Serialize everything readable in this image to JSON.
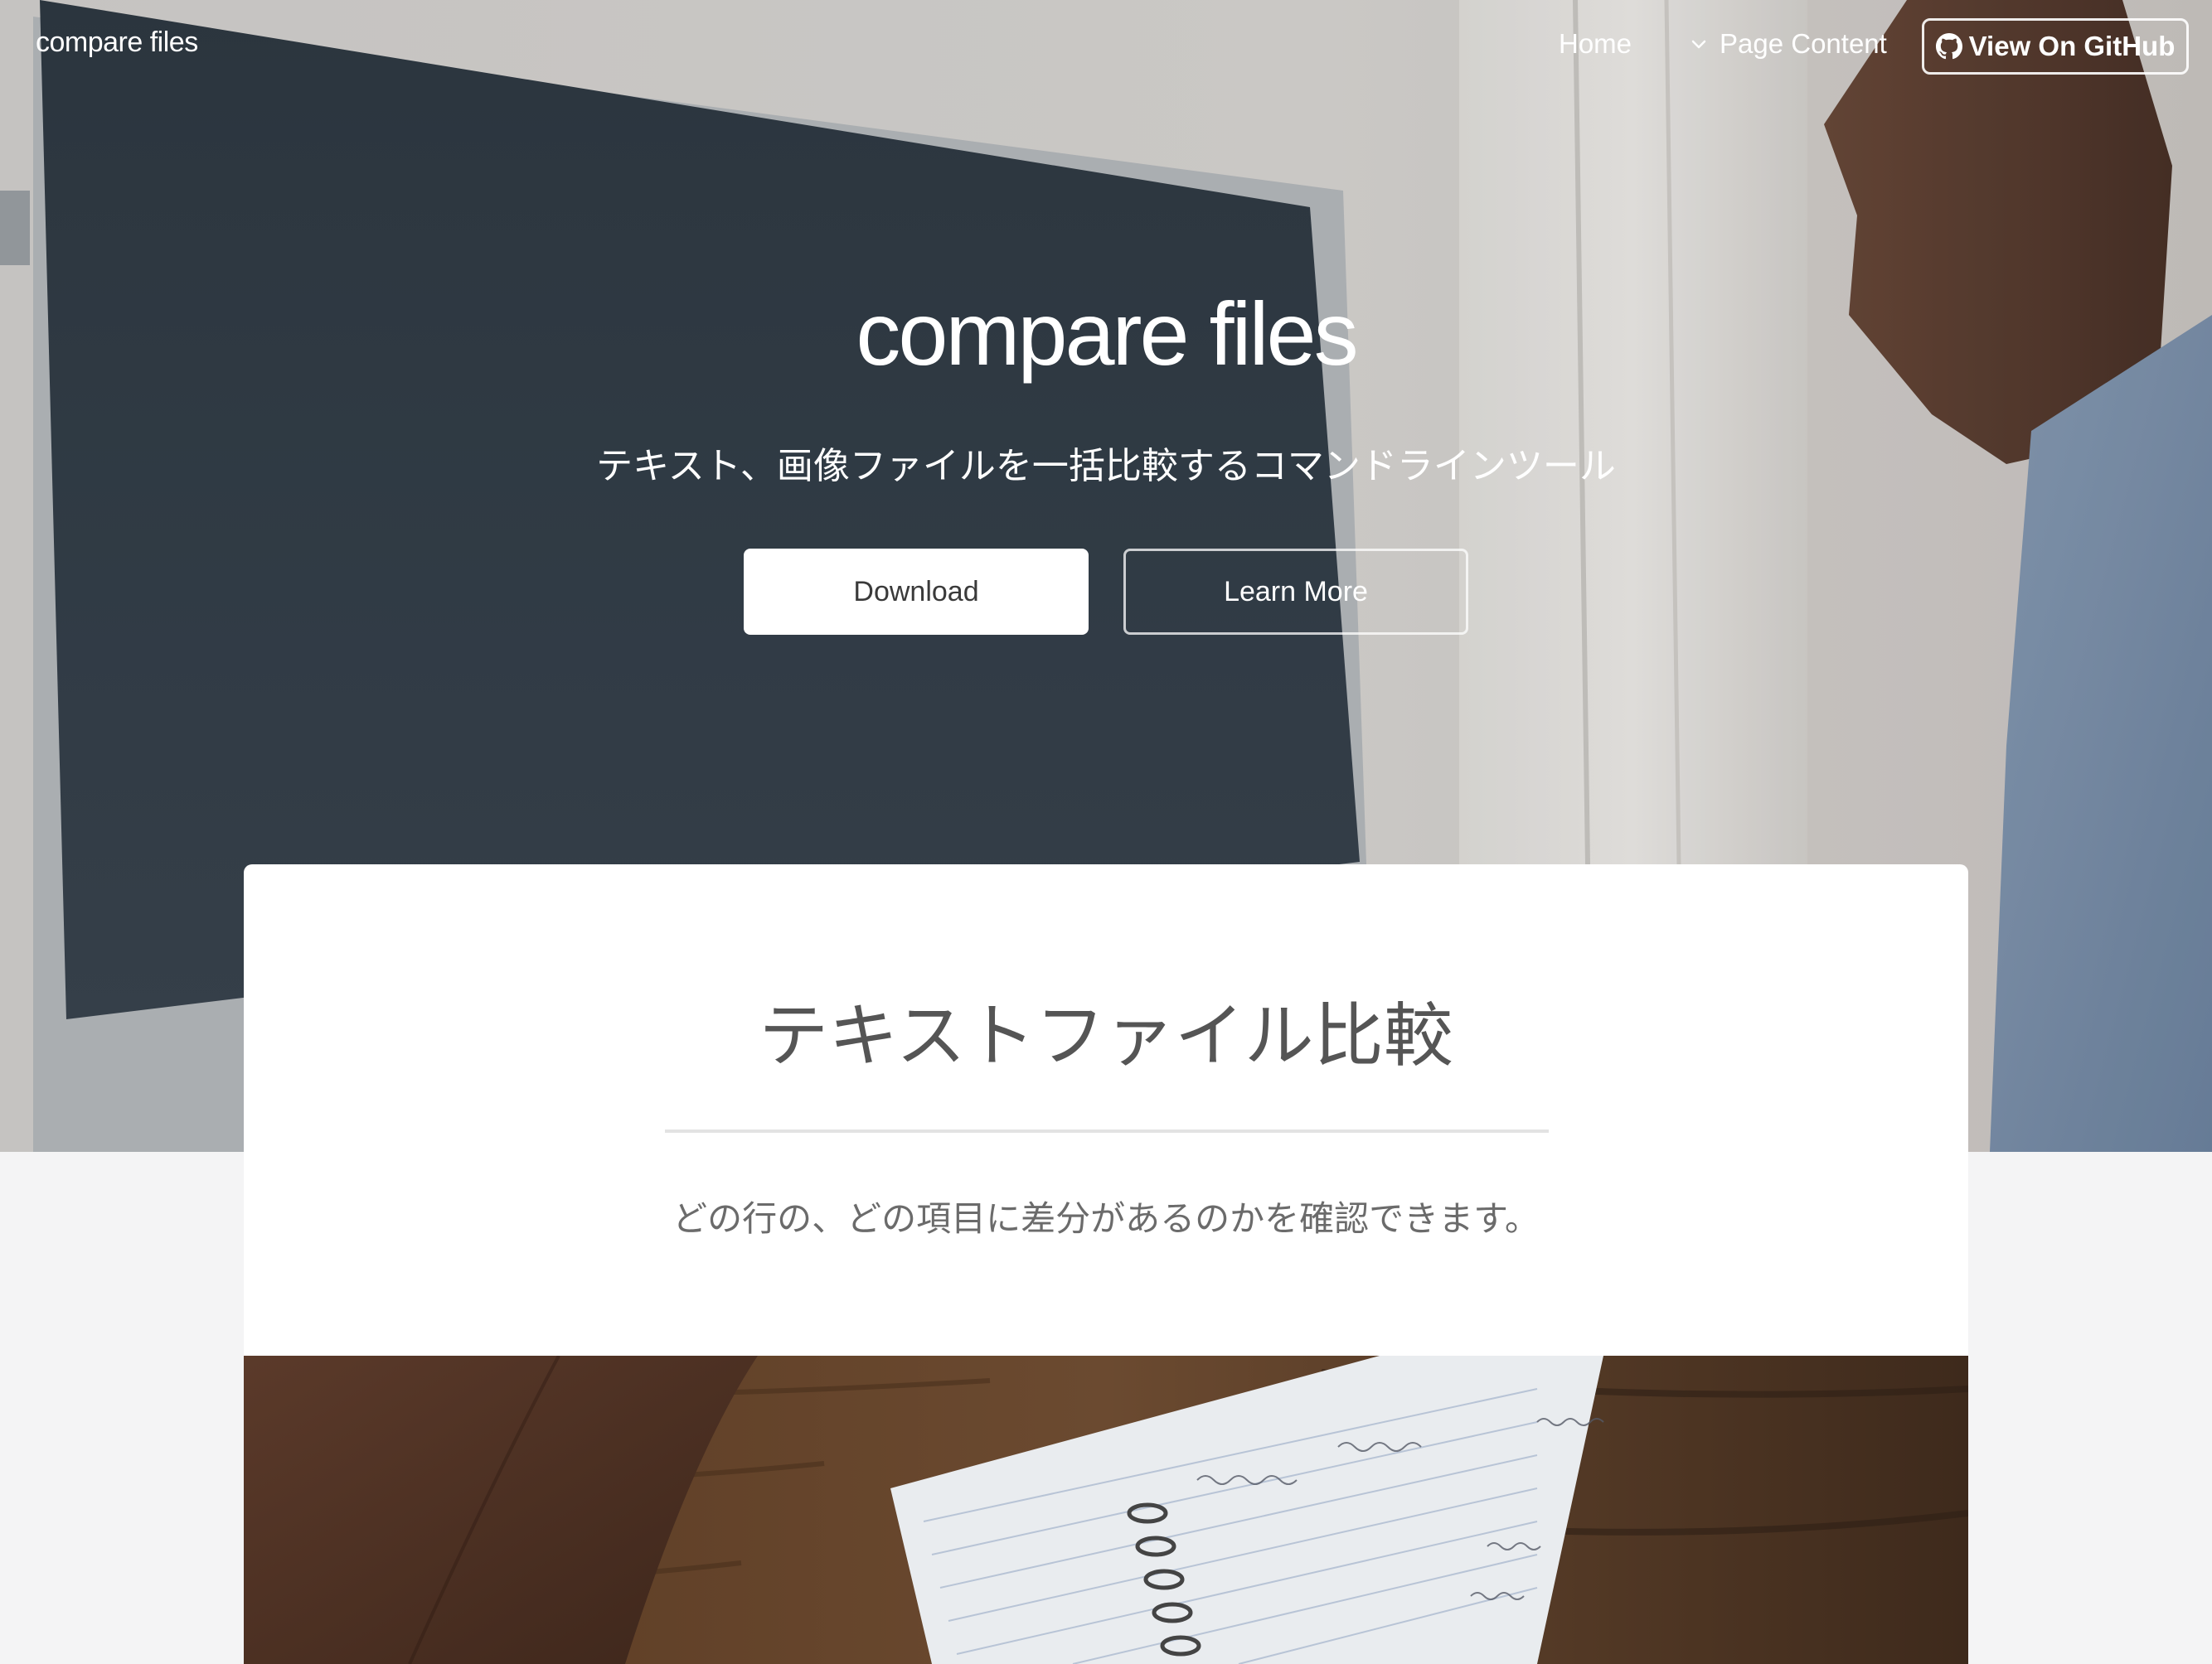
{
  "navbar": {
    "brand": "compare files",
    "home": "Home",
    "page_content": "Page Content",
    "github_button": "View On GitHub"
  },
  "hero": {
    "title": "compare files",
    "subtitle": "テキスト、画像ファイルを一括比較するコマンドラインツール",
    "download_button": "Download",
    "learn_more_button": "Learn More"
  },
  "section": {
    "title": "テキストファイル比較",
    "description": "どの行の、どの項目に差分があるのかを確認できます。"
  },
  "icons": {
    "dropdown": "chevron-down-icon",
    "github": "github-icon"
  },
  "colors": {
    "page_background": "#f4f4f5",
    "card_background": "#ffffff",
    "heading_text": "#555555",
    "body_text": "#6b6b6b",
    "button_fill": "#ffffff"
  }
}
